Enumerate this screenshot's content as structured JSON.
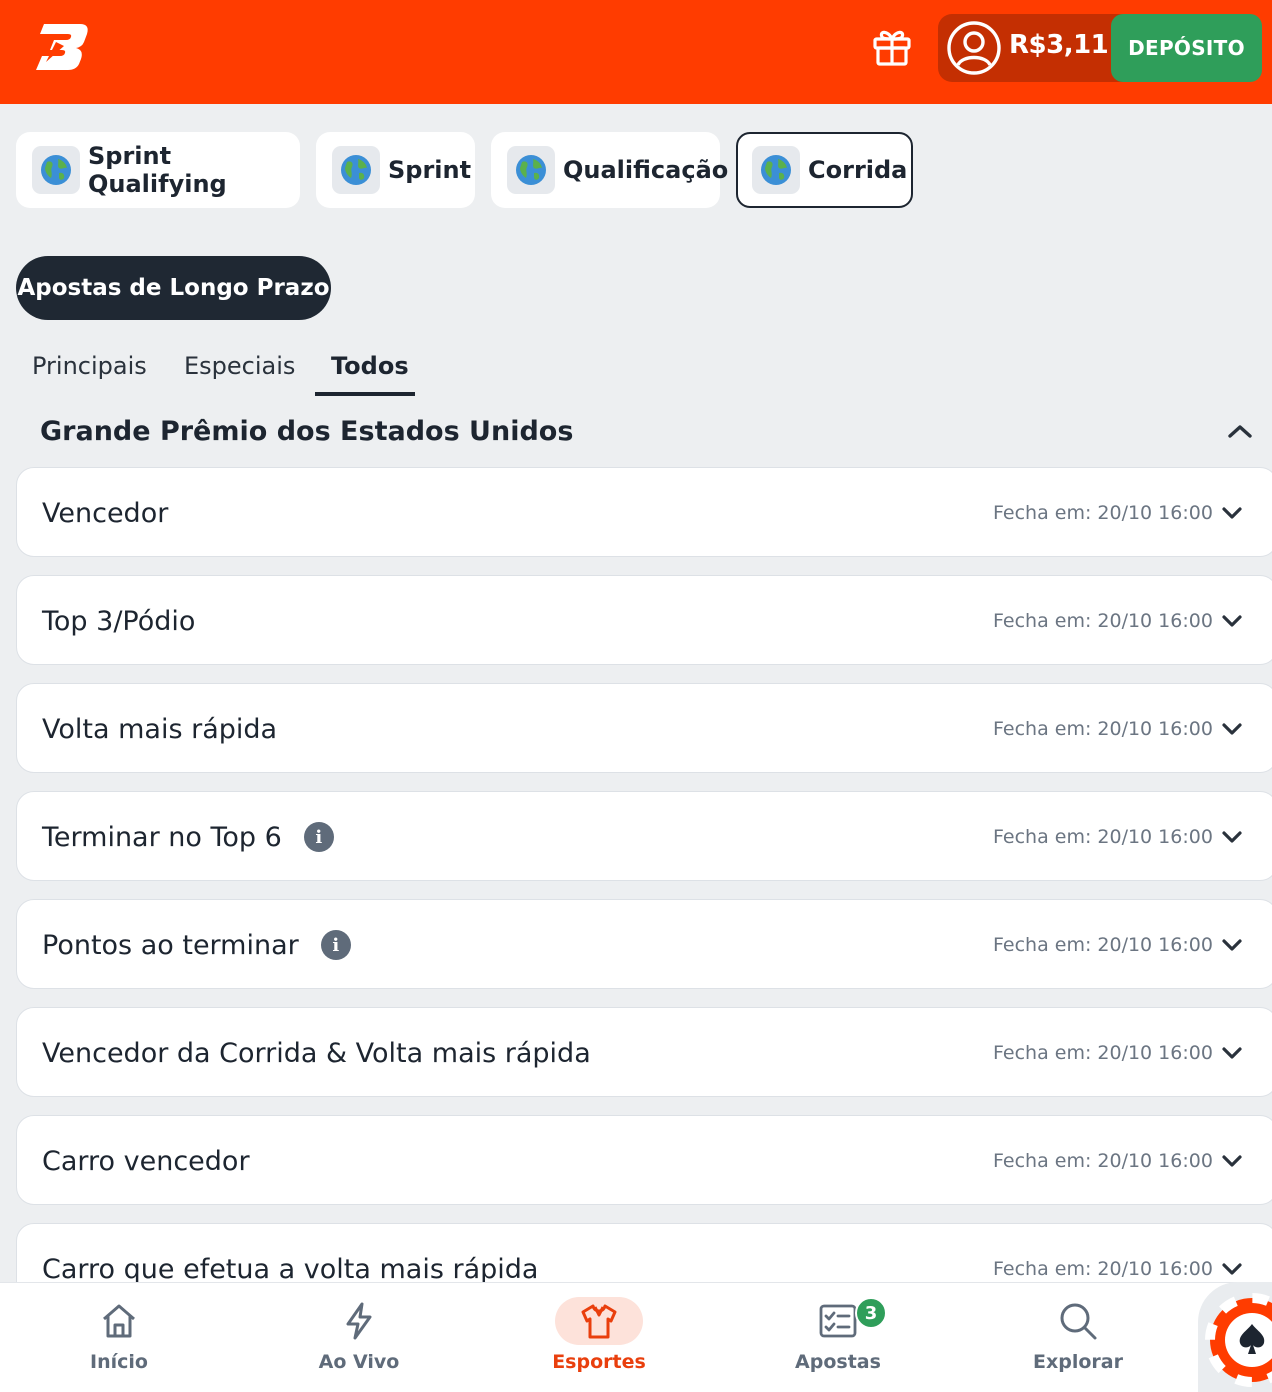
{
  "header": {
    "balance": "R$3,11",
    "deposit_label": "DEPÓSITO",
    "brand_color": "#ff3c00",
    "deposit_color": "#2f9e5a"
  },
  "categories": [
    {
      "label": "Sprint Qualifying",
      "icon": "globe-icon",
      "active": false
    },
    {
      "label": "Sprint",
      "icon": "globe-icon",
      "active": false
    },
    {
      "label": "Qualificação",
      "icon": "globe-icon",
      "active": false
    },
    {
      "label": "Corrida",
      "icon": "globe-icon",
      "active": true
    }
  ],
  "long_term_label": "Apostas de Longo Prazo",
  "tabs": [
    {
      "label": "Principais",
      "active": false
    },
    {
      "label": "Especiais",
      "active": false
    },
    {
      "label": "Todos",
      "active": true
    }
  ],
  "section": {
    "title": "Grande Prêmio dos Estados Unidos"
  },
  "markets": [
    {
      "name": "Vencedor",
      "closes": "Fecha em: 20/10 16:00",
      "info": false
    },
    {
      "name": "Top 3/Pódio",
      "closes": "Fecha em: 20/10 16:00",
      "info": false
    },
    {
      "name": "Volta mais rápida",
      "closes": "Fecha em: 20/10 16:00",
      "info": false
    },
    {
      "name": "Terminar no Top 6",
      "closes": "Fecha em: 20/10 16:00",
      "info": true
    },
    {
      "name": "Pontos ao terminar",
      "closes": "Fecha em: 20/10 16:00",
      "info": true
    },
    {
      "name": "Vencedor da Corrida & Volta mais rápida",
      "closes": "Fecha em: 20/10 16:00",
      "info": false
    },
    {
      "name": "Carro vencedor",
      "closes": "Fecha em: 20/10 16:00",
      "info": false
    },
    {
      "name": "Carro que efetua a volta mais rápida",
      "closes": "Fecha em: 20/10 16:00",
      "info": false
    }
  ],
  "info_glyph": "i",
  "bottom_nav": [
    {
      "label": "Início",
      "icon": "home-icon",
      "active": false
    },
    {
      "label": "Ao Vivo",
      "icon": "lightning-icon",
      "active": false
    },
    {
      "label": "Esportes",
      "icon": "jersey-icon",
      "active": true
    },
    {
      "label": "Apostas",
      "icon": "betslip-icon",
      "active": false,
      "badge": "3"
    },
    {
      "label": "Explorar",
      "icon": "search-icon",
      "active": false
    }
  ],
  "accent_color": "#e93f0d"
}
